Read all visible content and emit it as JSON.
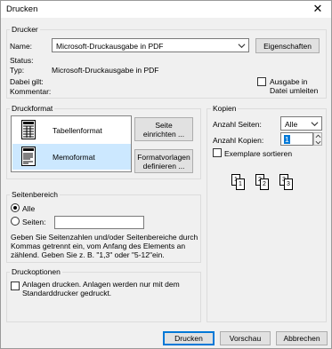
{
  "window": {
    "title": "Drucken",
    "close_icon": "close-icon"
  },
  "printer": {
    "group_label": "Drucker",
    "name_label": "Name:",
    "name_value": "Microsoft-Druckausgabe in PDF",
    "properties_button": "Eigenschaften",
    "status_label": "Status:",
    "status_value": "",
    "type_label": "Typ:",
    "type_value": "Microsoft-Druckausgabe in PDF",
    "where_label": "Dabei gilt:",
    "where_value": "",
    "comment_label": "Kommentar:",
    "comment_value": "",
    "print_to_file_label": "Ausgabe in Datei umleiten",
    "print_to_file_checked": false
  },
  "print_format": {
    "group_label": "Druckformat",
    "items": [
      {
        "label": "Tabellenformat",
        "selected": false,
        "icon": "table-style-icon"
      },
      {
        "label": "Memoformat",
        "selected": true,
        "icon": "memo-style-icon"
      }
    ],
    "page_setup_button": "Seite einrichten ...",
    "define_styles_button": "Formatvorlagen definieren ..."
  },
  "copies": {
    "group_label": "Kopien",
    "pages_label": "Anzahl Seiten:",
    "pages_value": "Alle",
    "copies_label": "Anzahl Kopien:",
    "copies_value": "1",
    "collate_label": "Exemplare sortieren",
    "collate_checked": false,
    "collate_pages": [
      "1",
      "1",
      "2",
      "2",
      "3",
      "3"
    ]
  },
  "page_range": {
    "group_label": "Seitenbereich",
    "all_label": "Alle",
    "all_selected": true,
    "pages_label": "Seiten:",
    "pages_value": "",
    "hint": "Geben Sie Seitenzahlen und/oder Seitenbereiche durch Kommas getrennt ein, vom Anfang des Elements an zählend. Geben Sie z. B. \"1,3\" oder \"5-12\"ein."
  },
  "print_options": {
    "group_label": "Druckoptionen",
    "attachments_label": "Anlagen drucken. Anlagen werden nur mit dem Standarddrucker gedruckt.",
    "attachments_checked": false
  },
  "footer": {
    "print_button": "Drucken",
    "preview_button": "Vorschau",
    "cancel_button": "Abbrechen"
  }
}
